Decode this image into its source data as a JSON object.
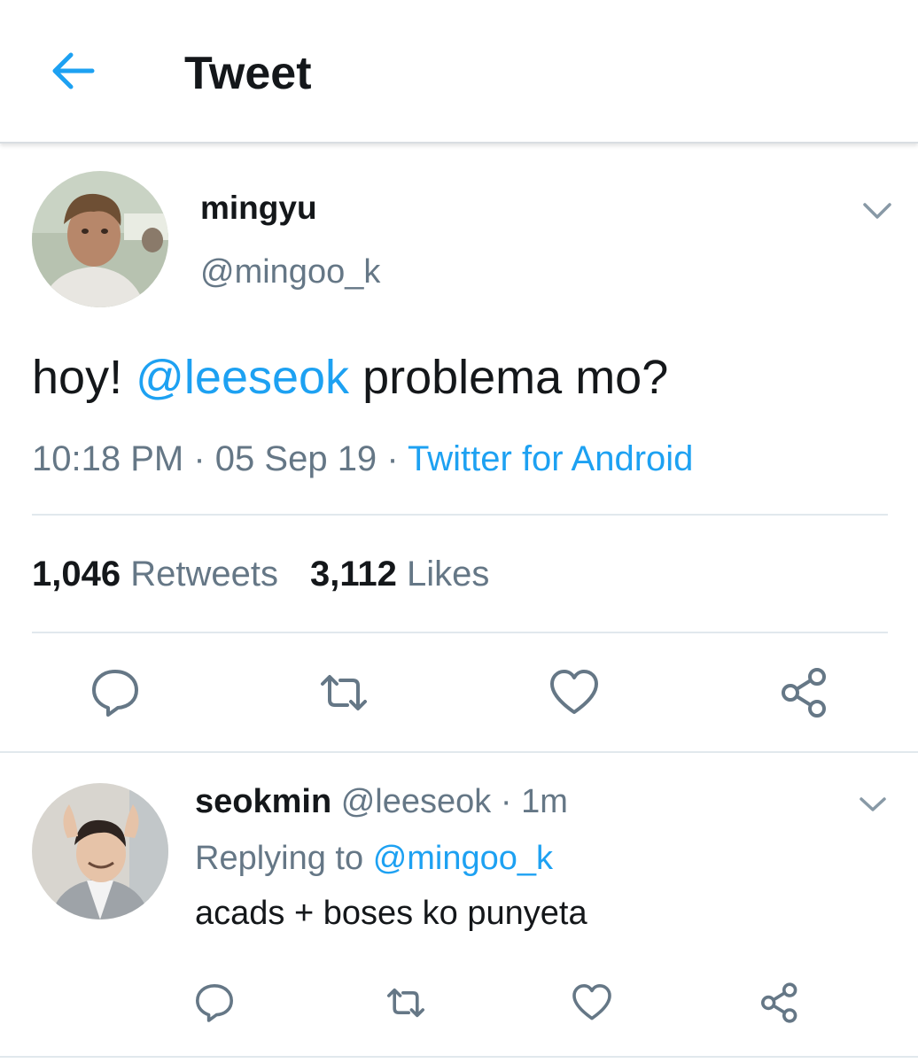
{
  "header": {
    "title": "Tweet",
    "back_icon": "arrow-left-icon"
  },
  "colors": {
    "accent": "#1da1f2",
    "text_primary": "#14171a",
    "text_secondary": "#657786",
    "divider": "#e1e8ed"
  },
  "tweet": {
    "display_name": "mingyu",
    "handle": "@mingoo_k",
    "text_prefix": "hoy!",
    "mention": "@leeseok",
    "text_suffix": "problema mo?",
    "time": "10:18 PM",
    "dot": "·",
    "date": "05 Sep 19",
    "source": "Twitter for Android",
    "retweets_count": "1,046",
    "retweets_label": "Retweets",
    "likes_count": "3,112",
    "likes_label": "Likes"
  },
  "reply": {
    "display_name": "seokmin",
    "handle": "@leeseok",
    "dot": "·",
    "time": "1m",
    "replying_label": "Replying to",
    "replying_to": "@mingoo_k",
    "text": "acads + boses ko punyeta"
  },
  "actions": [
    "reply-icon",
    "retweet-icon",
    "like-icon",
    "share-icon"
  ]
}
